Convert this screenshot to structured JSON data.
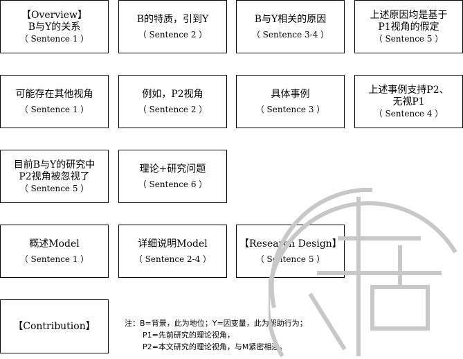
{
  "boxes": [
    {
      "title": "【Overview】\nB与Y的关系",
      "sentence": "（ Sentence 1 ）"
    },
    {
      "title": "B的特质，引到Y",
      "sentence": "（ Sentence 2 ）"
    },
    {
      "title": "B与Y相关的原因",
      "sentence": "（ Sentence 3-4 ）"
    },
    {
      "title": "上述原因均是基于\nP1视角的假定",
      "sentence": "（ Sentence 5 ）"
    },
    {
      "title": "可能存在其他视角",
      "sentence": "（ Sentence 1 ）"
    },
    {
      "title": "例如，P2视角",
      "sentence": "（ Sentence 2 ）"
    },
    {
      "title": "具体事例",
      "sentence": "（ Sentence 3 ）"
    },
    {
      "title": "上述事例支持P2、\n无视P1",
      "sentence": "（ Sentence 4 ）"
    },
    {
      "title": "目前B与Y的研究中\nP2视角被忽视了",
      "sentence": "（ Sentence 5 ）"
    },
    {
      "title": "理论+研究问题",
      "sentence": "（ Sentence 6 ）"
    },
    {
      "title": "概述Model",
      "sentence": "（ Sentence 1 ）"
    },
    {
      "title": "详细说明Model",
      "sentence": "（ Sentence 2-4 ）"
    },
    {
      "title": "【Research Design】",
      "sentence": "（ Sentence 5 ）"
    },
    {
      "title": "【Contribution】",
      "sentence": ""
    }
  ],
  "note": {
    "line1": "注：B=背景，此为地位；Y=因变量，此为帮助行为；",
    "line2": "P1=先前研究的理论视角，",
    "line3": "P2=本文研究的理论视角，与M紧密相连。"
  },
  "watermark": {
    "color": "#c8c8c8"
  }
}
